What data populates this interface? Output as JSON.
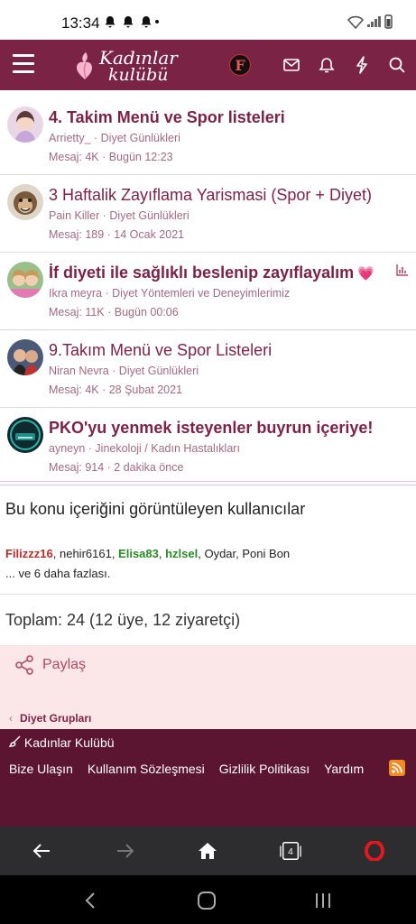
{
  "status": {
    "time": "13:34",
    "notif_icons": "•"
  },
  "appbar": {
    "logo_line1": "Kadınlar",
    "logo_line2": "kulübü",
    "user_initial": "F"
  },
  "threads": [
    {
      "title": "4. Takim Menü ve Spor listeleri",
      "bold": true,
      "author": "Arrietty_",
      "forum": "Diyet Günlükleri",
      "messages_label": "Mesaj:",
      "messages": "4K",
      "time": "Bugün 12:23"
    },
    {
      "title": "3 Haftalik Zayıflama Yarismasi (Spor + Diyet)",
      "bold": false,
      "author": "Pain Killer",
      "forum": "Diyet Günlükleri",
      "messages_label": "Mesaj:",
      "messages": "189",
      "time": "14 Ocak 2021"
    },
    {
      "title": "İf diyeti ile sağlıklı beslenip zayıflayalım",
      "bold": true,
      "author": "Ikra meyra",
      "forum": "Diyet Yöntemleri ve Deneyimlerimiz",
      "messages_label": "Mesaj:",
      "messages": "11K",
      "time": "Bugün 00:06"
    },
    {
      "title": "9.Takım Menü ve Spor Listeleri",
      "bold": false,
      "author": "Niran Nevra",
      "forum": "Diyet Günlükleri",
      "messages_label": "Mesaj:",
      "messages": "4K",
      "time": "28 Şubat 2021"
    },
    {
      "title": "PKO'yu yenmek isteyenler buyrun içeriye!",
      "bold": true,
      "author": "ayneyn",
      "forum": "Jinekoloji / Kadın Hastalıkları",
      "messages_label": "Mesaj:",
      "messages": "914",
      "time": "2 dakika önce"
    }
  ],
  "viewers": {
    "title": "Bu konu içeriğini görüntüleyen kullanıcılar",
    "u1": "Filizzz16",
    "u2": "nehir6161",
    "u3": "Elisa83",
    "u4": "hzlsel",
    "u5": "Oydar",
    "u6": "Poni Bon",
    "more": "... ve 6 daha fazlası."
  },
  "total": "Toplam: 24 (12 üye, 12 ziyaretçi)",
  "share": {
    "label": "Paylaş"
  },
  "breadcrumb": {
    "label": "Diyet Grupları"
  },
  "footer": {
    "brand": "Kadınlar Kulübü",
    "links": [
      "Bize Ulaşın",
      "Kullanım Sözleşmesi",
      "Gizlilik Politikası",
      "Yardım"
    ]
  },
  "browser": {
    "tab_count": "4"
  },
  "colors": {
    "primary": "#7b2345",
    "footer": "#5c1531",
    "share_bg": "#fbe6e8"
  }
}
